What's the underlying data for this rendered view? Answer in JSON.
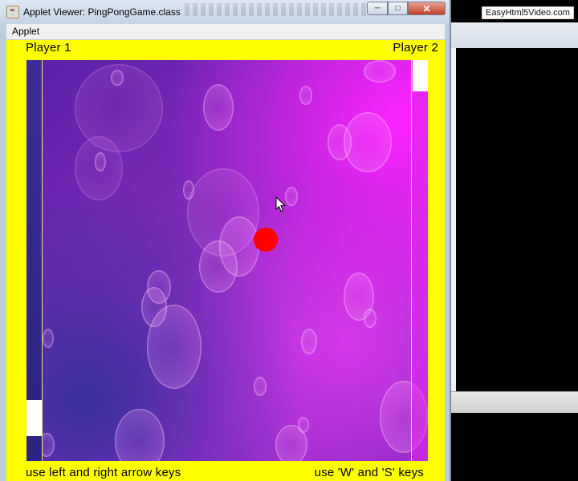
{
  "window": {
    "title": "Applet Viewer: PingPongGame.class",
    "icon": "java-cup-icon",
    "controls": {
      "minimize": "─",
      "maximize": "□",
      "close": "✕"
    }
  },
  "menu": {
    "items": [
      "Applet"
    ]
  },
  "game": {
    "player1_label": "Player 1",
    "player2_label": "Player 2",
    "player1_hint": "use left and right arrow keys",
    "player2_hint": "use 'W' and 'S' keys",
    "colors": {
      "border": "#ffff00",
      "ball": "#ff0000",
      "paddle": "#ffffff"
    }
  },
  "watermark": "EasyHtml5Video.com"
}
